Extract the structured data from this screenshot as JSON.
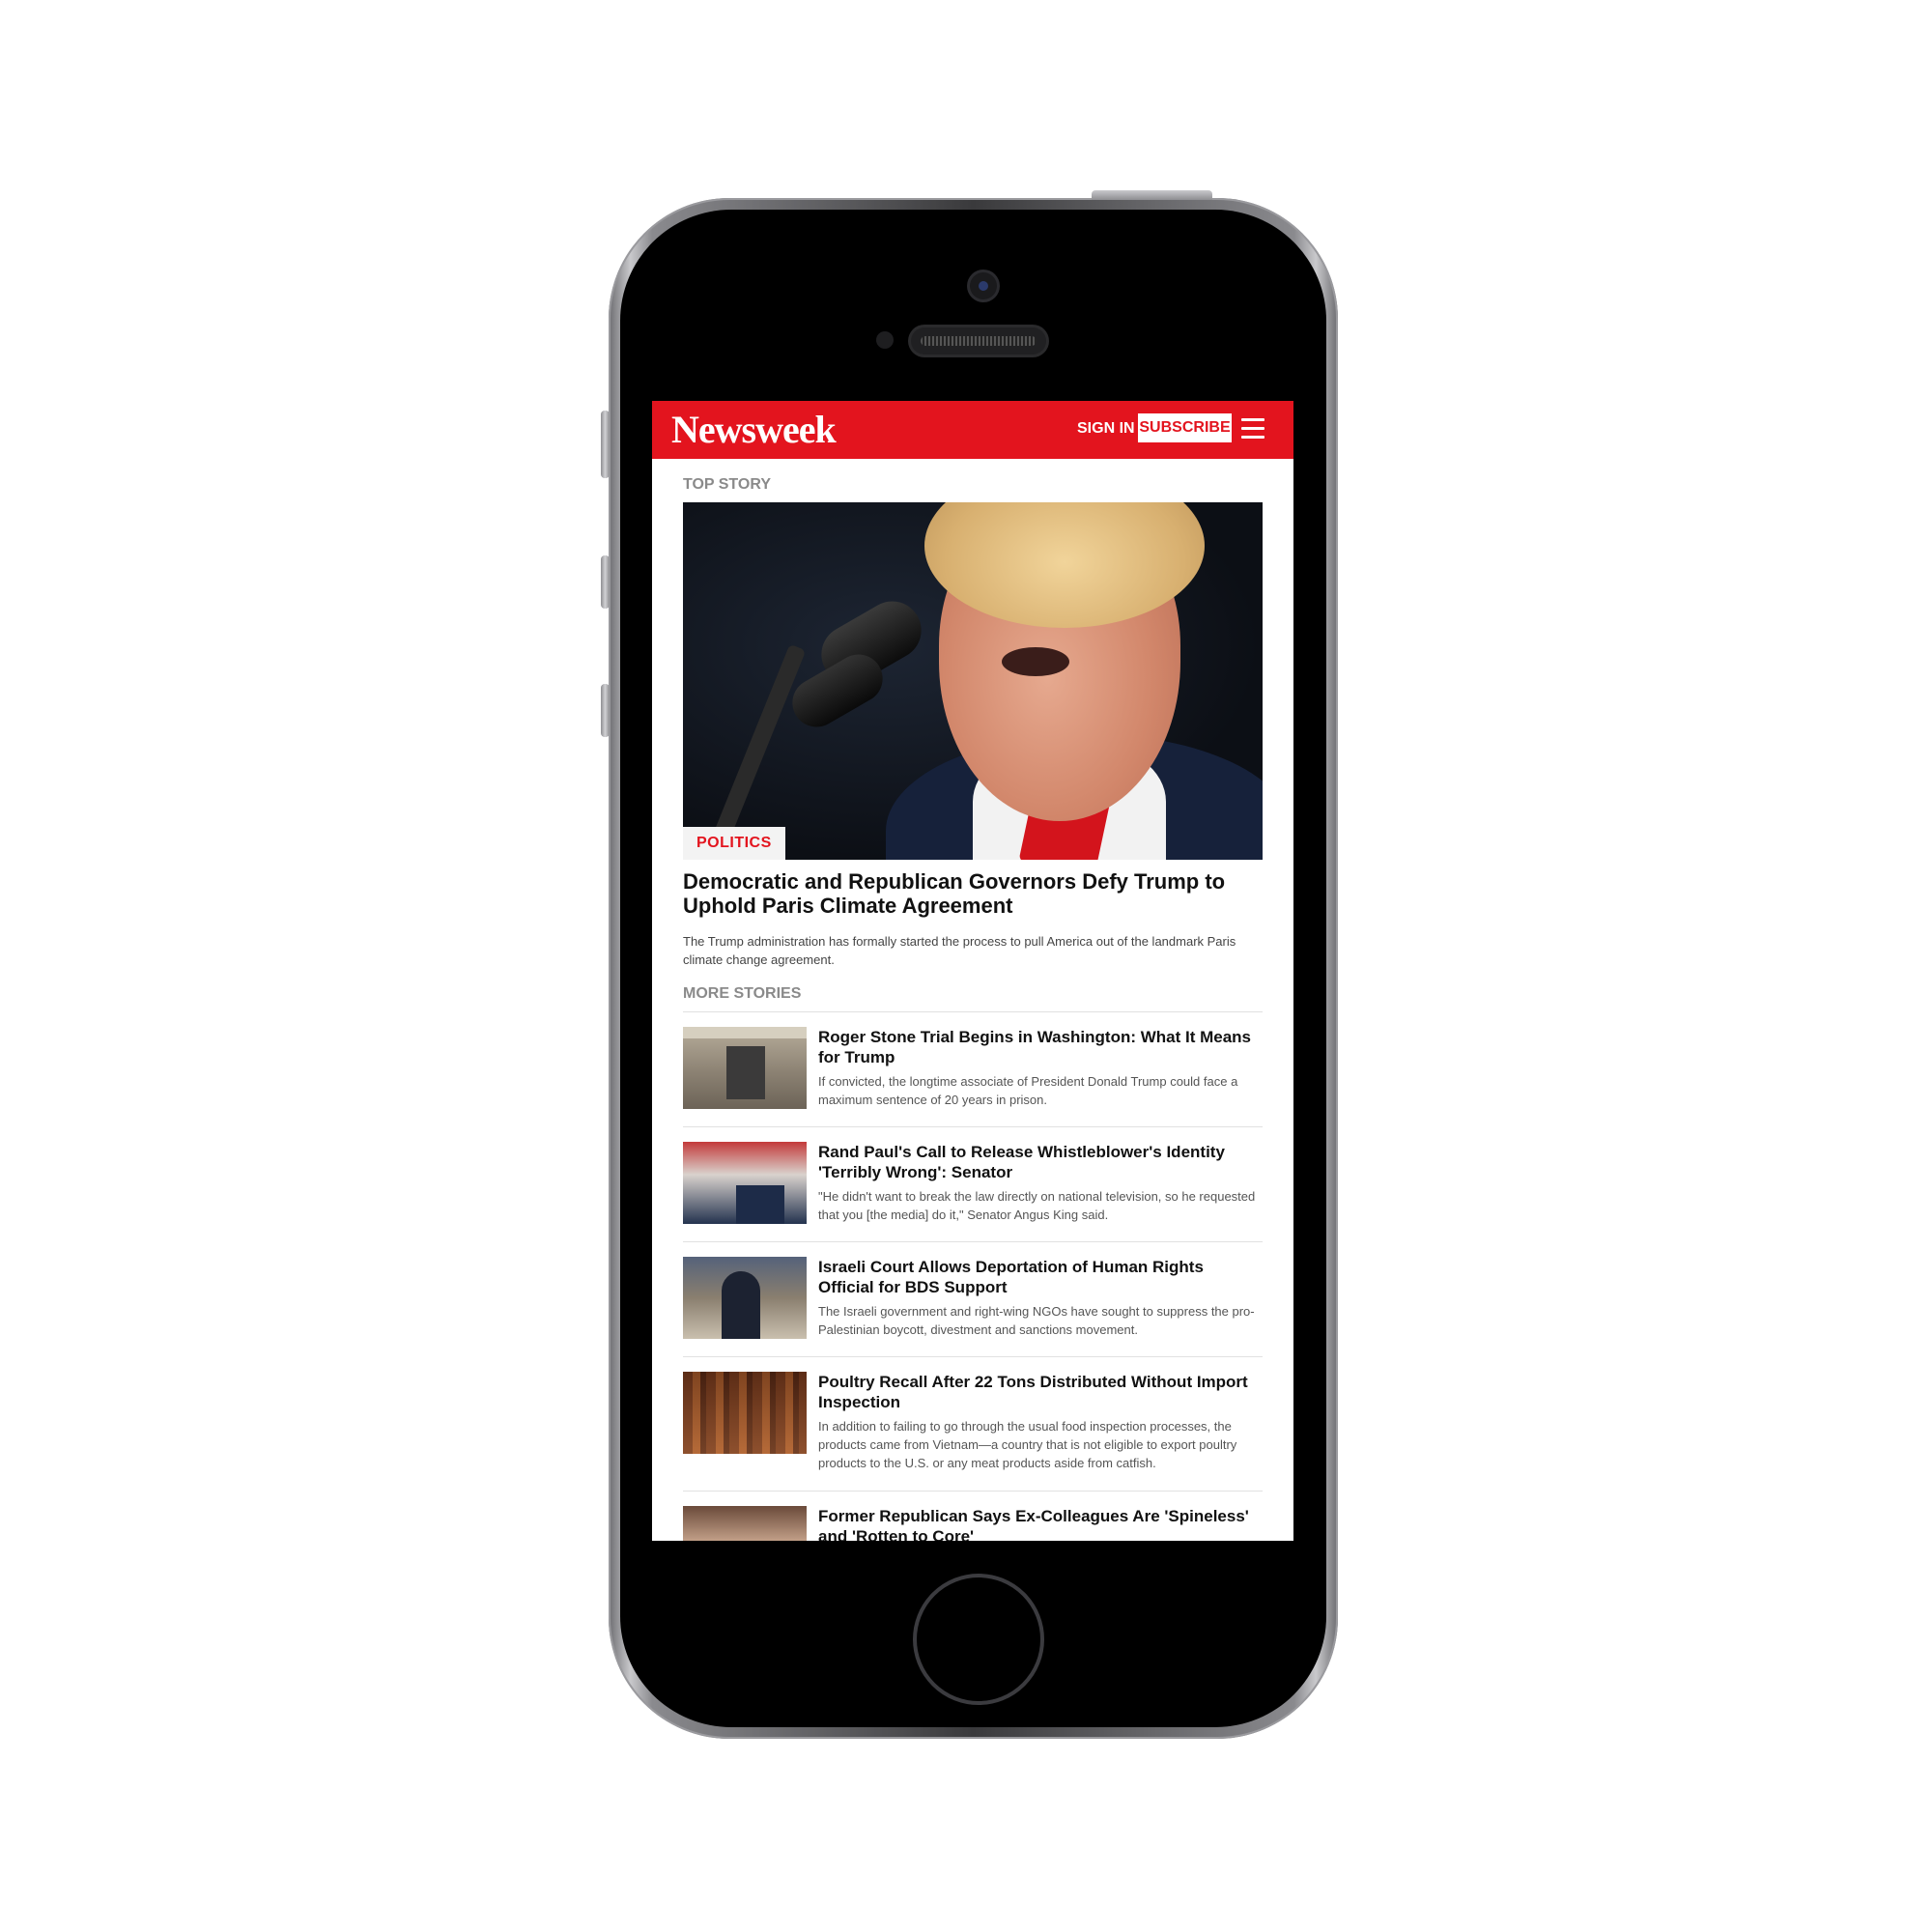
{
  "brand": {
    "logo": "Newsweek",
    "accent": "#e3141e"
  },
  "header": {
    "sign_in": "SIGN IN",
    "subscribe": "SUBSCRIBE",
    "menu_icon": "hamburger-menu-icon"
  },
  "top_story": {
    "section_label": "TOP STORY",
    "tag": "POLITICS",
    "title": "Democratic and Republican Governors Defy Trump to Uphold Paris Climate Agreement",
    "summary": "The Trump administration has formally started the process to pull America out of the landmark Paris climate change agreement."
  },
  "more_stories": {
    "section_label": "MORE STORIES",
    "items": [
      {
        "title": "Roger Stone Trial Begins in Washington: What It Means for Trump",
        "summary": "If convicted, the longtime associate of President Donald Trump could face a maximum sentence of 20 years in prison."
      },
      {
        "title": "Rand Paul's Call to Release Whistleblower's Identity 'Terribly Wrong': Senator",
        "summary": "\"He didn't want to break the law directly on national television, so he requested that you [the media] do it,\" Senator Angus King said."
      },
      {
        "title": "Israeli Court Allows Deportation of Human Rights Official for BDS Support",
        "summary": "The Israeli government and right-wing NGOs have sought to suppress the pro-Palestinian boycott, divestment and sanctions movement."
      },
      {
        "title": "Poultry Recall After 22 Tons Distributed Without Import Inspection",
        "summary": "In addition to failing to go through the usual food inspection processes, the products came from Vietnam—a country that is not eligible to export poultry products to the U.S. or any meat products aside from catfish."
      },
      {
        "title": "Former Republican Says Ex-Colleagues Are 'Spineless' and 'Rotten to Core'",
        "summary": ""
      }
    ]
  }
}
